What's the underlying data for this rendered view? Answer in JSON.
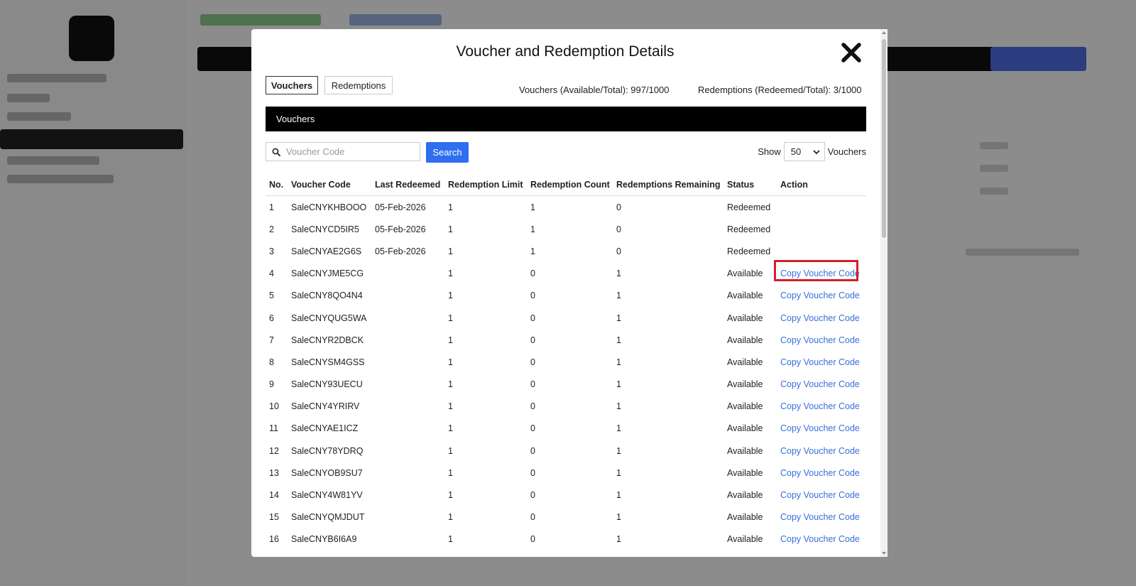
{
  "modal": {
    "title": "Voucher and Redemption Details",
    "tabs": [
      {
        "label": "Vouchers",
        "active": true
      },
      {
        "label": "Redemptions",
        "active": false
      }
    ],
    "stats": {
      "vouchers": "Vouchers (Available/Total): 997/1000",
      "redemptions": "Redemptions (Redeemed/Total): 3/1000"
    },
    "section_title": "Vouchers",
    "search": {
      "placeholder": "Voucher Code",
      "button_label": "Search"
    },
    "show": {
      "label": "Show",
      "selected": "50",
      "suffix": "Vouchers"
    },
    "table": {
      "columns": [
        "No.",
        "Voucher Code",
        "Last Redeemed",
        "Redemption Limit",
        "Redemption Count",
        "Redemptions Remaining",
        "Status",
        "Action"
      ],
      "rows": [
        {
          "no": "1",
          "code": "SaleCNYKHBOOO",
          "last": "05-Feb-2026",
          "limit": "1",
          "count": "1",
          "remaining": "0",
          "status": "Redeemed",
          "action": ""
        },
        {
          "no": "2",
          "code": "SaleCNYCD5IR5",
          "last": "05-Feb-2026",
          "limit": "1",
          "count": "1",
          "remaining": "0",
          "status": "Redeemed",
          "action": ""
        },
        {
          "no": "3",
          "code": "SaleCNYAE2G6S",
          "last": "05-Feb-2026",
          "limit": "1",
          "count": "1",
          "remaining": "0",
          "status": "Redeemed",
          "action": ""
        },
        {
          "no": "4",
          "code": "SaleCNYJME5CG",
          "last": "",
          "limit": "1",
          "count": "0",
          "remaining": "1",
          "status": "Available",
          "action": "Copy Voucher Code"
        },
        {
          "no": "5",
          "code": "SaleCNY8QO4N4",
          "last": "",
          "limit": "1",
          "count": "0",
          "remaining": "1",
          "status": "Available",
          "action": "Copy Voucher Code"
        },
        {
          "no": "6",
          "code": "SaleCNYQUG5WA",
          "last": "",
          "limit": "1",
          "count": "0",
          "remaining": "1",
          "status": "Available",
          "action": "Copy Voucher Code"
        },
        {
          "no": "7",
          "code": "SaleCNYR2DBCK",
          "last": "",
          "limit": "1",
          "count": "0",
          "remaining": "1",
          "status": "Available",
          "action": "Copy Voucher Code"
        },
        {
          "no": "8",
          "code": "SaleCNYSM4GSS",
          "last": "",
          "limit": "1",
          "count": "0",
          "remaining": "1",
          "status": "Available",
          "action": "Copy Voucher Code"
        },
        {
          "no": "9",
          "code": "SaleCNY93UECU",
          "last": "",
          "limit": "1",
          "count": "0",
          "remaining": "1",
          "status": "Available",
          "action": "Copy Voucher Code"
        },
        {
          "no": "10",
          "code": "SaleCNY4YRIRV",
          "last": "",
          "limit": "1",
          "count": "0",
          "remaining": "1",
          "status": "Available",
          "action": "Copy Voucher Code"
        },
        {
          "no": "11",
          "code": "SaleCNYAE1ICZ",
          "last": "",
          "limit": "1",
          "count": "0",
          "remaining": "1",
          "status": "Available",
          "action": "Copy Voucher Code"
        },
        {
          "no": "12",
          "code": "SaleCNY78YDRQ",
          "last": "",
          "limit": "1",
          "count": "0",
          "remaining": "1",
          "status": "Available",
          "action": "Copy Voucher Code"
        },
        {
          "no": "13",
          "code": "SaleCNYOB9SU7",
          "last": "",
          "limit": "1",
          "count": "0",
          "remaining": "1",
          "status": "Available",
          "action": "Copy Voucher Code"
        },
        {
          "no": "14",
          "code": "SaleCNY4W81YV",
          "last": "",
          "limit": "1",
          "count": "0",
          "remaining": "1",
          "status": "Available",
          "action": "Copy Voucher Code"
        },
        {
          "no": "15",
          "code": "SaleCNYQMJDUT",
          "last": "",
          "limit": "1",
          "count": "0",
          "remaining": "1",
          "status": "Available",
          "action": "Copy Voucher Code"
        },
        {
          "no": "16",
          "code": "SaleCNYB6I6A9",
          "last": "",
          "limit": "1",
          "count": "0",
          "remaining": "1",
          "status": "Available",
          "action": "Copy Voucher Code"
        }
      ]
    },
    "close_icon": "close-icon",
    "highlight_color": "#d4202a",
    "accent_color": "#2f6ef0"
  }
}
